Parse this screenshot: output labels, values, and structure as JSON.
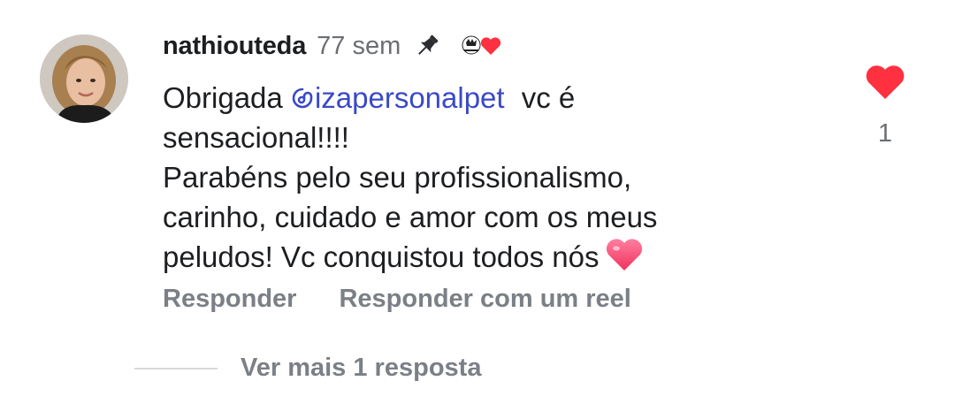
{
  "comment": {
    "username": "nathiouteda",
    "time": "77 sem",
    "icons": {
      "avatar": "profile-photo",
      "pin": "pin-icon",
      "badge": "author-liked-heart-icon",
      "like": "heart-filled-icon"
    },
    "text": {
      "line1_prefix": "Obrigada",
      "mention": "izapersonalpet",
      "line1_suffix": " vc é",
      "line2": "sensacional!!!!",
      "line3": "Parabéns pelo seu profissionalismo,",
      "line4": "carinho, cuidado e amor com os meus",
      "line5": "peludos! Vc conquistou todos nós"
    },
    "emoji": "pink-heart-emoji",
    "likes_count": "1",
    "actions": {
      "reply": "Responder",
      "reply_reel": "Responder com um reel"
    },
    "view_replies": "Ver mais 1 resposta"
  },
  "colors": {
    "like_red": "#ff3040",
    "mention_blue": "#3a49c7",
    "secondary_text": "#7b7f86"
  }
}
